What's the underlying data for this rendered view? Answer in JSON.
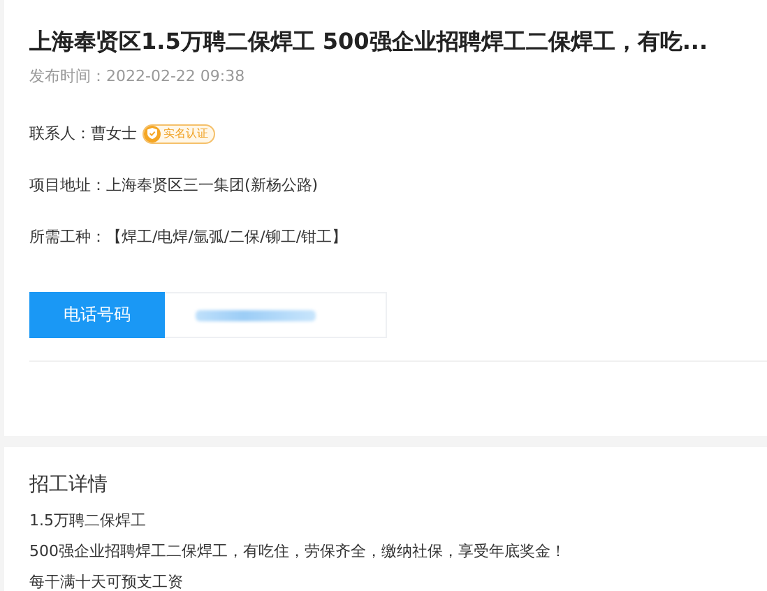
{
  "job": {
    "title": "上海奉贤区1.5万聘二保焊工 500强企业招聘焊工二保焊工，有吃...",
    "published_label": "发布时间：",
    "published": "2022-02-22 09:38",
    "fields": [
      {
        "label": "联系人：",
        "value": "曹女士",
        "badge": "实名认证"
      },
      {
        "label": "项目地址：",
        "value": "上海奉贤区三一集团(新杨公路)"
      },
      {
        "label": "所需工种：",
        "value": "【焊工/电焊/氩弧/二保/铆工/钳工】"
      }
    ],
    "phone_button": "电话号码"
  },
  "details": {
    "heading": "招工详情",
    "lines": [
      "1.5万聘二保焊工",
      "500强企业招聘焊工二保焊工，有吃住，劳保齐全，缴纳社保，享受年底奖金！",
      "每干满十天可预支工资"
    ]
  }
}
